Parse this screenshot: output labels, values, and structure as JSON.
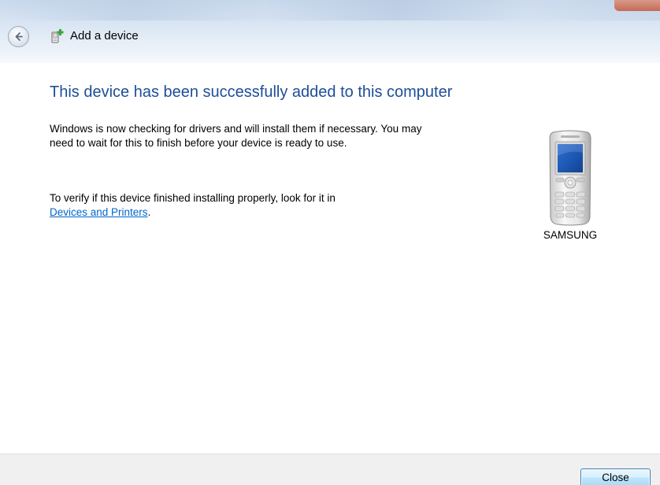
{
  "window": {
    "title": "Add a device"
  },
  "main": {
    "heading": "This device has been successfully added to this computer",
    "paragraph1": "Windows is now checking for drivers and will install them if necessary. You may need to wait for this to finish before your device is ready to use.",
    "paragraph2_prefix": "To verify if this device finished installing properly, look for it in",
    "link_text": "Devices and Printers",
    "paragraph2_suffix": "."
  },
  "device": {
    "name": "SAMSUNG",
    "icon": "mobile-phone-icon"
  },
  "footer": {
    "close_label": "Close"
  },
  "icons": {
    "back": "back-arrow-icon",
    "title": "add-device-icon"
  },
  "colors": {
    "heading": "#1e4e99",
    "link": "#0066cc",
    "footer_bg": "#f0f0f0"
  }
}
